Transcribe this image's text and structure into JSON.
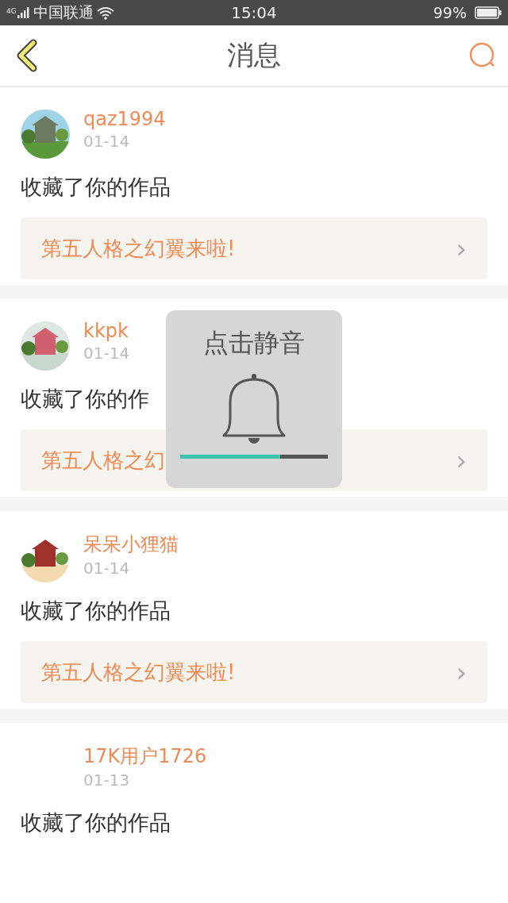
{
  "status_bar": {
    "network": "4G",
    "carrier": "中国联通",
    "time": "15:04",
    "battery": "99%"
  },
  "header": {
    "title": "消息"
  },
  "messages": [
    {
      "user": "qaz1994",
      "date": "01-14",
      "text": "收藏了你的作品",
      "work": "第五人格之幻翼来啦!",
      "chevron": "›"
    },
    {
      "user": "kkpk",
      "date": "01-14",
      "text": "收藏了你的作",
      "work": "第五人格之幻",
      "chevron": "›"
    },
    {
      "user": "呆呆小狸猫",
      "date": "01-14",
      "text": "收藏了你的作品",
      "work": "第五人格之幻翼来啦!",
      "chevron": "›"
    },
    {
      "user": "17K用户1726",
      "date": "01-13",
      "text": "收藏了你的作品"
    }
  ],
  "volume_popup": {
    "title": "点击静音",
    "level": 0.68
  }
}
